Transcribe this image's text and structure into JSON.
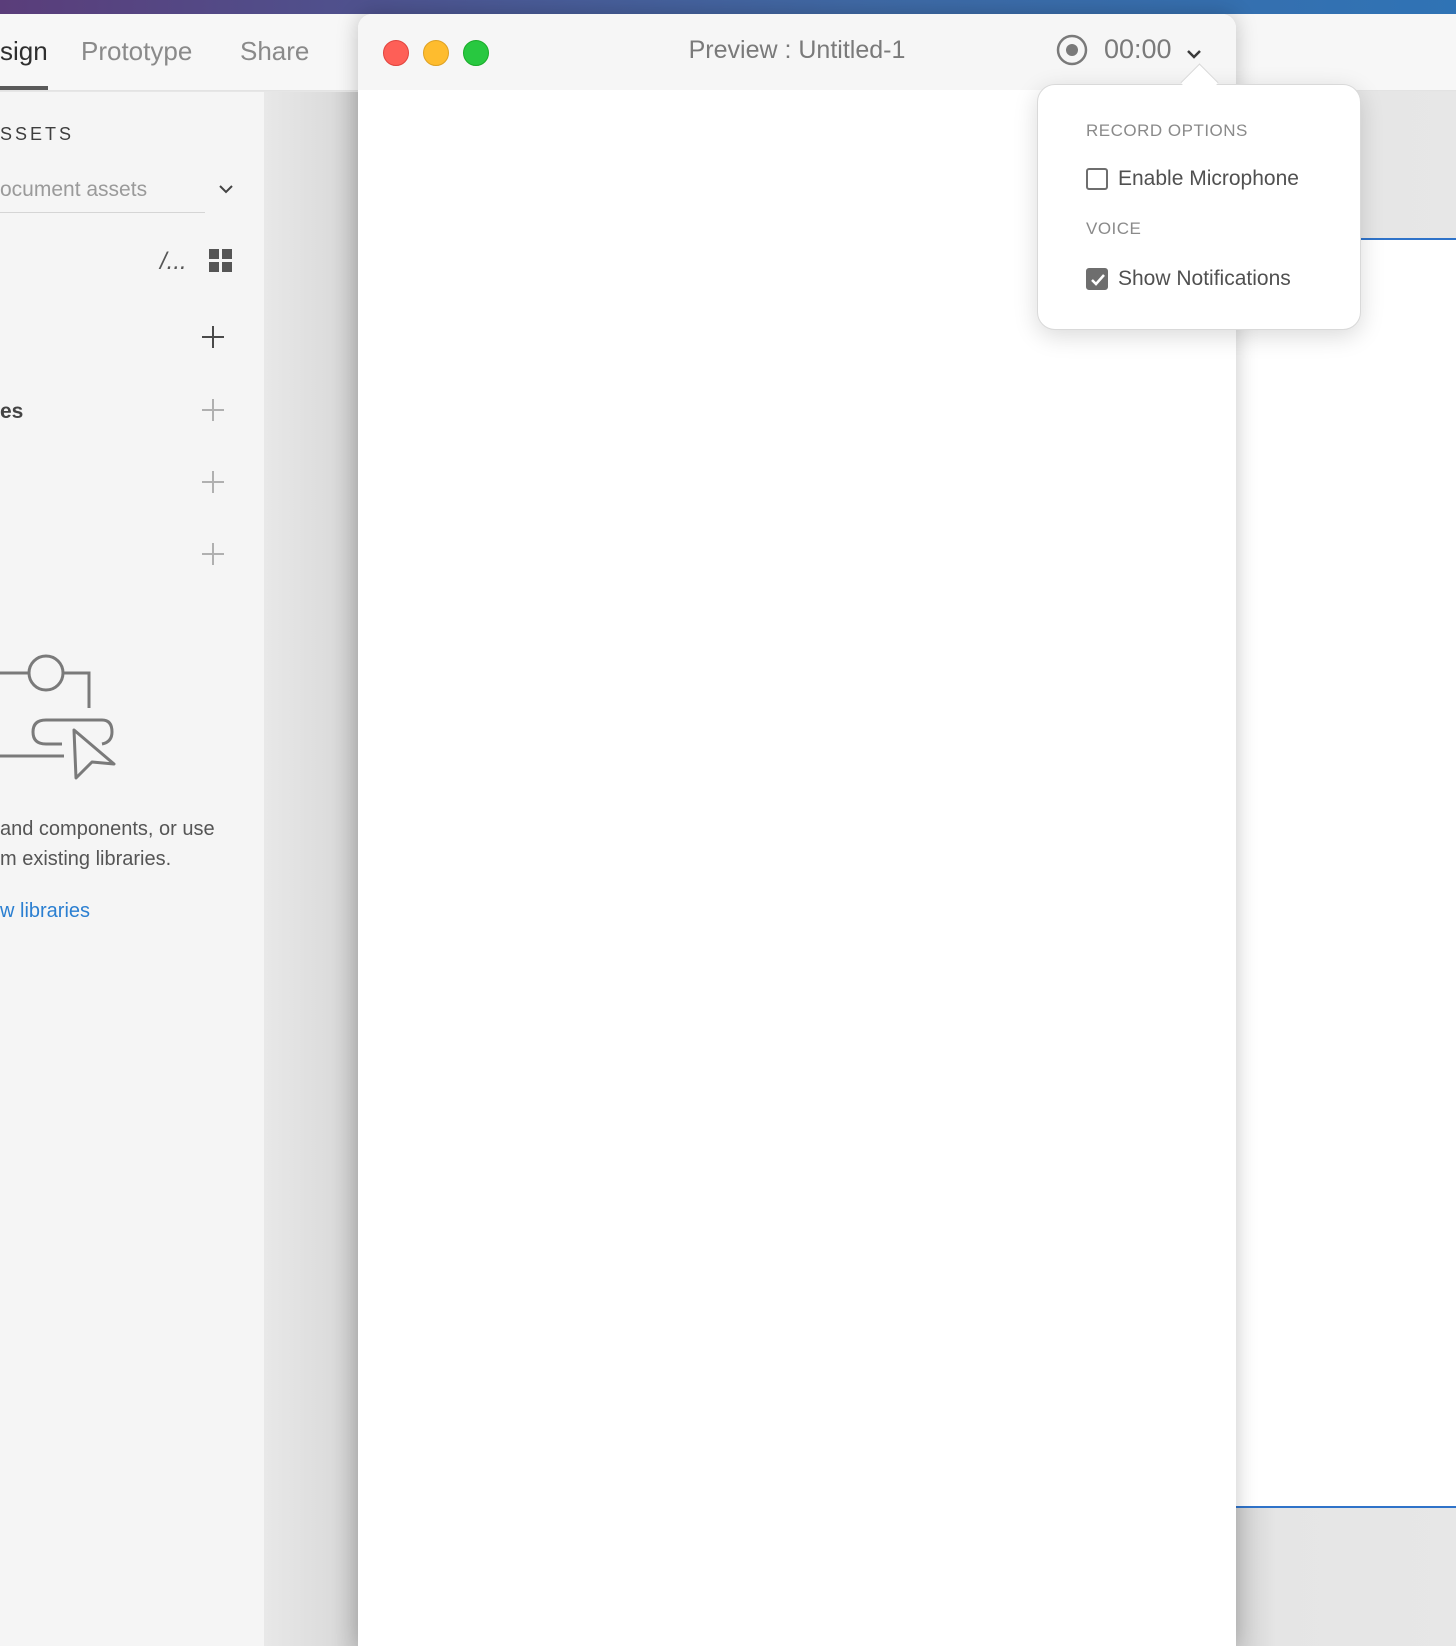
{
  "tabs": {
    "design": "sign",
    "prototype": "Prototype",
    "share": "Share"
  },
  "sidebar": {
    "assets_title": "SSETS",
    "assets_select": "ocument assets",
    "path_label": "/...",
    "section_label": "es",
    "empty_line1": "and components, or use",
    "empty_line2": "m existing libraries.",
    "library_link": "w libraries"
  },
  "window": {
    "title": "Preview : Untitled-1",
    "timer": "00:00"
  },
  "popover": {
    "record_options_label": "RECORD OPTIONS",
    "enable_microphone_label": "Enable Microphone",
    "enable_microphone_checked": false,
    "voice_label": "VOICE",
    "show_notifications_label": "Show Notifications",
    "show_notifications_checked": true
  },
  "colors": {
    "link": "#2b7fd1",
    "artboard_border": "#2f73c9",
    "close": "#fe5f57",
    "minimize": "#febc2e",
    "zoom": "#28c840"
  }
}
